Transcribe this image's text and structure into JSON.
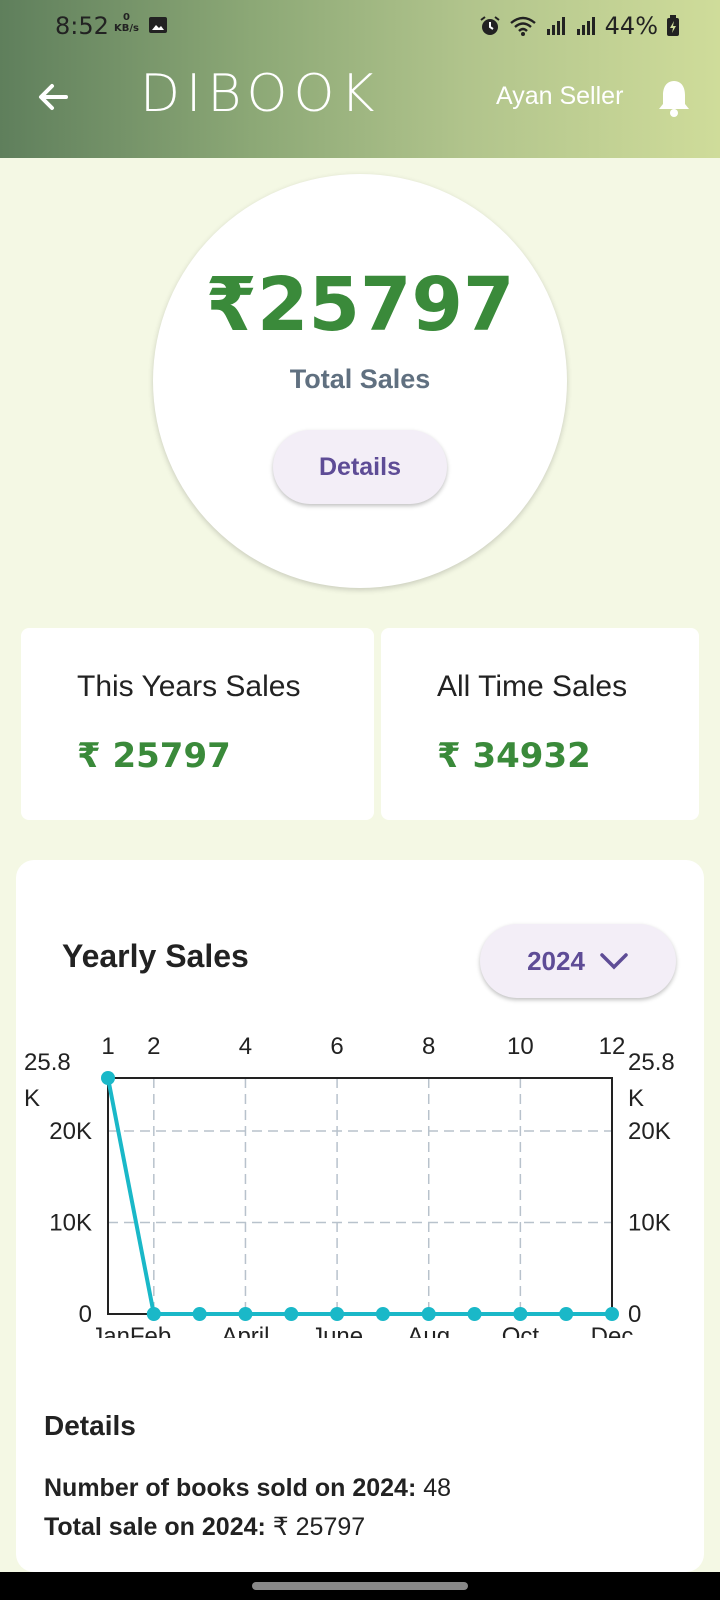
{
  "status": {
    "time": "8:52",
    "net_value": "0",
    "net_unit": "KB/s",
    "battery": "44%"
  },
  "header": {
    "brand": "DIBOOK",
    "user": "Ayan Seller"
  },
  "summary": {
    "amount": "₹25797",
    "label": "Total Sales",
    "details_button": "Details"
  },
  "cards": [
    {
      "title": "This Years Sales",
      "value": "₹ 25797"
    },
    {
      "title": "All Time Sales",
      "value": "₹ 34932"
    }
  ],
  "chart_section": {
    "title": "Yearly Sales",
    "year": "2024"
  },
  "chart_data": {
    "type": "line",
    "x": [
      1,
      2,
      3,
      4,
      5,
      6,
      7,
      8,
      9,
      10,
      11,
      12
    ],
    "values": [
      25797,
      0,
      0,
      0,
      0,
      0,
      0,
      0,
      0,
      0,
      0,
      0
    ],
    "top_ticks": [
      "1",
      "2",
      "4",
      "6",
      "8",
      "10",
      "12"
    ],
    "top_tick_positions": [
      1,
      2,
      4,
      6,
      8,
      10,
      12
    ],
    "bottom_ticks": [
      "Jan",
      "Feb",
      "April",
      "June",
      "Aug",
      "Oct",
      "Dec"
    ],
    "bottom_tick_positions": [
      1,
      2,
      4,
      6,
      8,
      10,
      12
    ],
    "y_ticks": [
      0,
      10000,
      20000,
      25797
    ],
    "y_tick_labels": [
      "0",
      "10K",
      "20K",
      "25.8\nK"
    ],
    "ylim": [
      0,
      25797
    ],
    "xlim": [
      1,
      12
    ],
    "grid": true,
    "color": "#1ab8c8"
  },
  "details": {
    "heading": "Details",
    "books_label": "Number of books sold on 2024:",
    "books_value": "48",
    "total_label": "Total sale on 2024:",
    "total_value": "₹ 25797"
  }
}
